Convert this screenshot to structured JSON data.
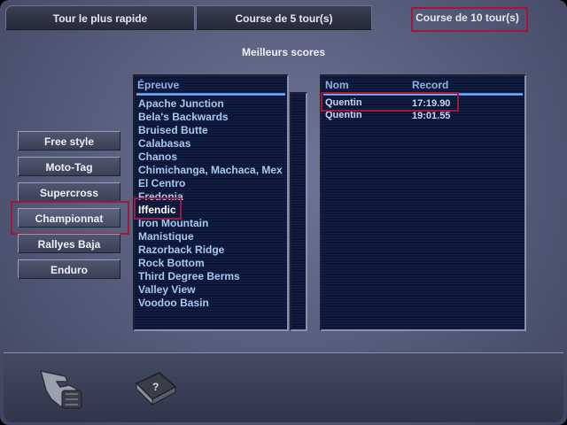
{
  "tabs": [
    {
      "label": "Tour le plus rapide"
    },
    {
      "label": "Course de 5 tour(s)"
    },
    {
      "label": "Course de 10 tour(s)"
    }
  ],
  "section_title": "Meilleurs scores",
  "modes": [
    {
      "label": "Free style"
    },
    {
      "label": "Moto-Tag"
    },
    {
      "label": "Supercross"
    },
    {
      "label": "Championnat"
    },
    {
      "label": "Rallyes Baja"
    },
    {
      "label": "Enduro"
    }
  ],
  "tracks": {
    "header": "Épreuve",
    "items": [
      "Apache Junction",
      "Bela's Backwards",
      "Bruised Butte",
      "Calabasas",
      "Chanos",
      "Chimichanga, Machaca, Mex",
      "El Centro",
      "Fredonia",
      "Iffendic",
      "Iron Mountain",
      "Manistique",
      "Razorback Ridge",
      "Rock Bottom",
      "Third Degree Berms",
      "Valley View",
      "Voodoo Basin"
    ],
    "selected": "Iffendic"
  },
  "scores": {
    "header_name": "Nom",
    "header_record": "Record",
    "rows": [
      {
        "name": "Quentin",
        "record": "17:19.90"
      },
      {
        "name": "Quentin",
        "record": "19:01.55"
      }
    ]
  },
  "icons": {
    "back": "pointing-hand-icon",
    "help": "help-book-icon"
  },
  "colors": {
    "highlight": "#a0183a",
    "list_text": "#a8c8f0",
    "header_text": "#8fb0e8"
  }
}
